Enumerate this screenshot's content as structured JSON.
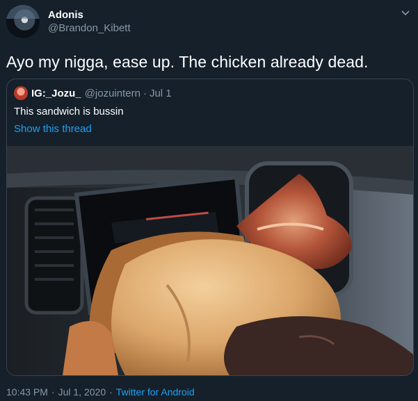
{
  "author": {
    "name": "Adonis",
    "handle": "@Brandon_Kibett"
  },
  "tweet": {
    "text": "Ayo my nigga, ease up. The chicken already dead."
  },
  "quoted": {
    "name": "IG:_Jozu_",
    "handle": "@jozuintern",
    "separator": "·",
    "date": "Jul 1",
    "text": "This sandwich is bussin",
    "thread_link": "Show this thread"
  },
  "footer": {
    "time": "10:43 PM",
    "separator": "·",
    "date": "Jul 1, 2020",
    "app": "Twitter for Android"
  },
  "icons": {
    "menu": "chevron-down-icon"
  },
  "colors": {
    "background": "#15202b",
    "secondary_text": "#8899a6",
    "link": "#1da1f2",
    "border": "#38444d"
  }
}
